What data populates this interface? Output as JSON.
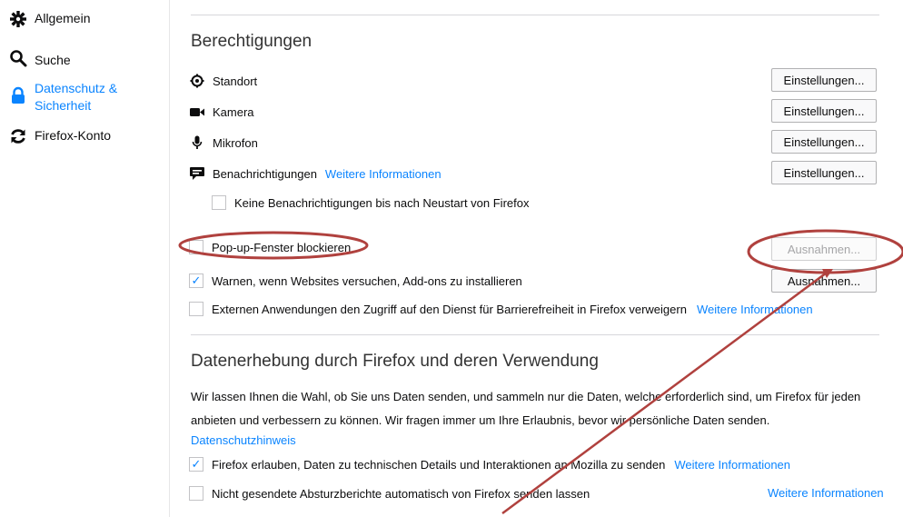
{
  "sidebar": {
    "items": [
      {
        "label": "Allgemein",
        "icon": "gear-icon"
      },
      {
        "label": "Suche",
        "icon": "search-icon"
      },
      {
        "label_line1": "Datenschutz &",
        "label_line2": "Sicherheit",
        "icon": "lock-icon",
        "active": true
      },
      {
        "label": "Firefox-Konto",
        "icon": "sync-icon"
      }
    ]
  },
  "permissions": {
    "title": "Berechtigungen",
    "rows": [
      {
        "label": "Standort",
        "icon": "location-icon",
        "button": "Einstellungen..."
      },
      {
        "label": "Kamera",
        "icon": "camera-icon",
        "button": "Einstellungen..."
      },
      {
        "label": "Mikrofon",
        "icon": "microphone-icon",
        "button": "Einstellungen..."
      },
      {
        "label": "Benachrichtigungen",
        "icon": "notification-icon",
        "link": "Weitere Informationen",
        "button": "Einstellungen..."
      }
    ],
    "notif_pause": {
      "label": "Keine Benachrichtigungen bis nach Neustart von Firefox",
      "checked": false
    },
    "popup": {
      "label": "Pop-up-Fenster blockieren",
      "checked": false,
      "button": "Ausnahmen..."
    },
    "addons": {
      "label": "Warnen, wenn Websites versuchen, Add-ons zu installieren",
      "checked": true,
      "button": "Ausnahmen..."
    },
    "a11y": {
      "label": "Externen Anwendungen den Zugriff auf den Dienst für Barrierefreiheit in Firefox verweigern",
      "checked": false,
      "link": "Weitere Informationen"
    }
  },
  "data_collection": {
    "title": "Datenerhebung durch Firefox und deren Verwendung",
    "para_line1": "Wir lassen Ihnen die Wahl, ob Sie uns Daten senden, und sammeln nur die Daten, welche erforderlich sind, um Firefox für jeden",
    "para_line2": "anbieten und verbessern zu können. Wir fragen immer um Ihre Erlaubnis, bevor wir persönliche Daten senden.",
    "privacy_link": "Datenschutzhinweis",
    "telemetry": {
      "label": "Firefox erlauben, Daten zu technischen Details und Interaktionen an Mozilla zu senden",
      "checked": true,
      "link": "Weitere Informationen"
    },
    "crash": {
      "label": "Nicht gesendete Absturzberichte automatisch von Firefox senden lassen",
      "checked": false,
      "link": "Weitere Informationen"
    }
  },
  "annotation": {
    "color": "#b0413e"
  }
}
